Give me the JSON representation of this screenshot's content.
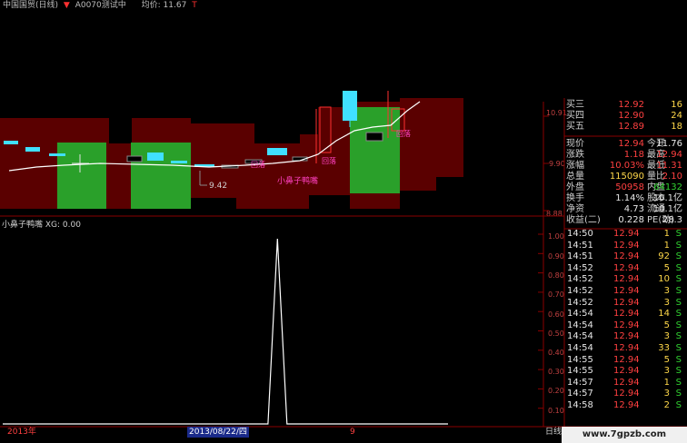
{
  "header": {
    "stock_name": "中国国贸(日线)",
    "indicator": "A0070测试中",
    "avg_label": "均价: 11.67",
    "price_marker": "▼",
    "price_marker2": "T"
  },
  "indicator_panel": {
    "title": "小鼻子鸭嘴  XG: 0.00"
  },
  "upper_chart": {
    "labels": {
      "low_price": "9.42",
      "pattern1": "小鼻子鸭嘴",
      "pattern2": "回落",
      "pattern3": "回落",
      "pattern4": "回落"
    }
  },
  "right_scale_upper": [
    "10.91",
    "9.90",
    "8.88"
  ],
  "right_scale_lower": [
    "1.00",
    "0.90",
    "0.80",
    "0.70",
    "0.60",
    "0.50",
    "0.40",
    "0.30",
    "0.20",
    "0.10"
  ],
  "quote": {
    "rows": [
      {
        "label": "买三",
        "val": "12.92",
        "val2": "16"
      },
      {
        "label": "买四",
        "val": "12.90",
        "val2": "24"
      },
      {
        "label": "买五",
        "val": "12.89",
        "val2": "18"
      }
    ],
    "stats": [
      {
        "l1": "现价",
        "v1": "12.94",
        "l2": "今开",
        "v2": "11.76"
      },
      {
        "l1": "涨跌",
        "v1": "1.18",
        "l2": "最高",
        "v2": "12.94"
      },
      {
        "l1": "涨幅",
        "v1": "10.03%",
        "l2": "最低",
        "v2": "11.31"
      },
      {
        "l1": "总量",
        "v1": "115090",
        "l2": "量比",
        "v2": "2.10"
      },
      {
        "l1": "外盘",
        "v1": "50958",
        "l2": "内盘",
        "v2": "64132"
      },
      {
        "l1": "换手",
        "v1": "1.14%",
        "l2": "股本",
        "v2": "10.1亿"
      },
      {
        "l1": "净资",
        "v1": "4.73",
        "l2": "流通",
        "v2": "10.1亿"
      },
      {
        "l1": "收益(二)",
        "v1": "0.228",
        "l2": "PE(动)",
        "v2": "28.3"
      }
    ]
  },
  "trades": [
    {
      "time": "14:50",
      "price": "12.94",
      "qty": "1",
      "side": "S"
    },
    {
      "time": "14:51",
      "price": "12.94",
      "qty": "1",
      "side": "S"
    },
    {
      "time": "14:51",
      "price": "12.94",
      "qty": "92",
      "side": "S"
    },
    {
      "time": "14:52",
      "price": "12.94",
      "qty": "5",
      "side": "S"
    },
    {
      "time": "14:52",
      "price": "12.94",
      "qty": "10",
      "side": "S"
    },
    {
      "time": "14:52",
      "price": "12.94",
      "qty": "3",
      "side": "S"
    },
    {
      "time": "14:52",
      "price": "12.94",
      "qty": "3",
      "side": "S"
    },
    {
      "time": "14:54",
      "price": "12.94",
      "qty": "14",
      "side": "S"
    },
    {
      "time": "14:54",
      "price": "12.94",
      "qty": "5",
      "side": "S"
    },
    {
      "time": "14:54",
      "price": "12.94",
      "qty": "3",
      "side": "S"
    },
    {
      "time": "14:54",
      "price": "12.94",
      "qty": "33",
      "side": "S"
    },
    {
      "time": "14:55",
      "price": "12.94",
      "qty": "5",
      "side": "S"
    },
    {
      "time": "14:55",
      "price": "12.94",
      "qty": "3",
      "side": "S"
    },
    {
      "time": "14:57",
      "price": "12.94",
      "qty": "1",
      "side": "S"
    },
    {
      "time": "14:57",
      "price": "12.94",
      "qty": "3",
      "side": "S"
    },
    {
      "time": "14:58",
      "price": "12.94",
      "qty": "2",
      "side": "S"
    }
  ],
  "bottom": {
    "year": "2013年",
    "date": "2013/08/22/四",
    "month": "9",
    "daily": "日线"
  },
  "watermark": "www.7gpzb.com",
  "colors": {
    "dark_red": "#5a0000",
    "green_block": "#2aa02a",
    "cyan_candle": "#40e0ff",
    "up_red": "#ff3030",
    "line_white": "#ffffff",
    "magenta_label": "#ff40c0"
  },
  "chart_data": {
    "type": "line",
    "x_labels": [
      "2013年",
      "2013/08/22/四",
      "9"
    ],
    "series": [
      {
        "values": [
          0,
          0,
          0,
          0,
          0,
          0,
          0,
          0,
          0,
          0,
          0,
          0,
          0,
          0,
          0,
          0,
          0,
          0,
          0,
          0,
          0,
          0,
          0,
          0,
          0,
          0,
          0,
          0,
          0,
          1,
          0,
          0,
          0,
          0,
          0,
          0,
          0,
          0,
          0,
          0,
          0,
          0,
          0,
          0,
          0,
          0,
          0,
          0
        ]
      }
    ],
    "ylim": [
      0,
      1.0
    ],
    "yticks": [
      "1.00",
      "0.90",
      "0.80",
      "0.70",
      "0.60",
      "0.50",
      "0.40",
      "0.30",
      "0.20",
      "0.10"
    ]
  }
}
